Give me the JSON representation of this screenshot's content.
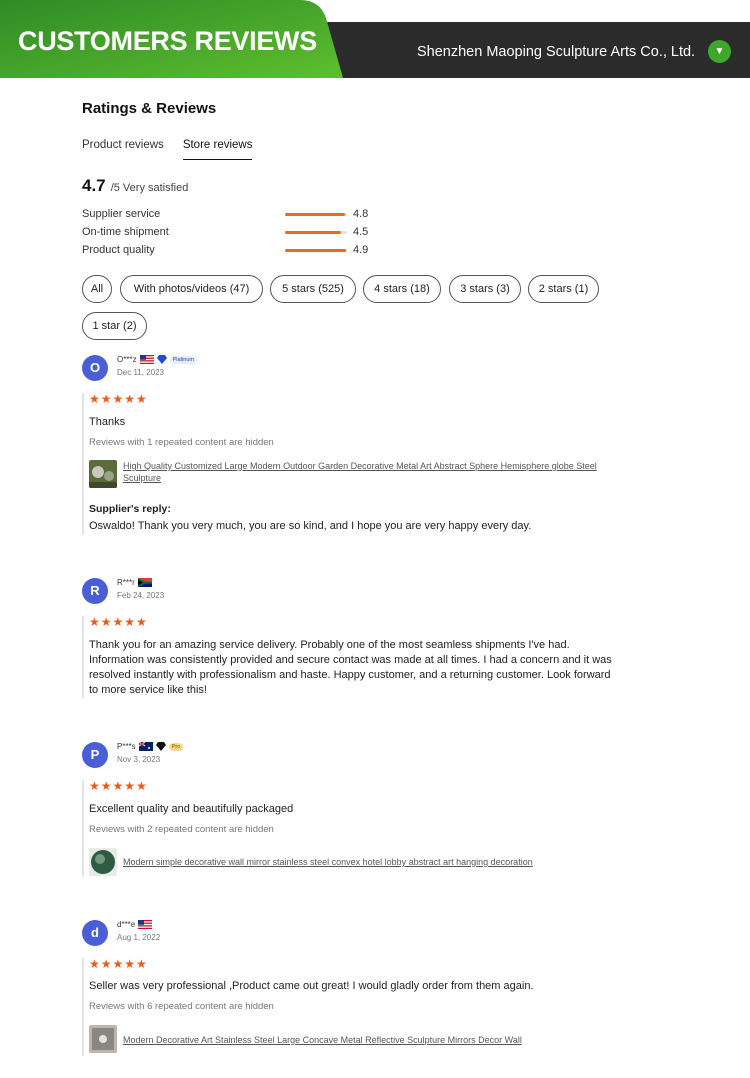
{
  "banner": {
    "title": "CUSTOMERS REVIEWS",
    "company": "Shenzhen Maoping Sculpture Arts Co., Ltd.",
    "dot_icon": "▼"
  },
  "ratings": {
    "title": "Ratings & Reviews",
    "tabs": [
      "Product reviews",
      "Store reviews"
    ],
    "active_tab": "Store reviews",
    "score": "4.7",
    "score_suffix": "/5 Very satisfied",
    "metrics": [
      {
        "label": "Supplier service",
        "value": "4.8",
        "fraction": 0.96
      },
      {
        "label": "On-time shipment",
        "value": "4.5",
        "fraction": 0.9
      },
      {
        "label": "Product quality",
        "value": "4.9",
        "fraction": 0.98
      }
    ]
  },
  "filters": [
    "All",
    "With photos/videos (47)",
    "5 stars (525)",
    "4 stars (18)",
    "3 stars (3)",
    "2 stars (1)",
    "1 star (2)"
  ],
  "reviews": [
    {
      "initial": "O",
      "name": "O***z",
      "badge": "Platinum",
      "date": "Dec 11, 2023",
      "stars": "★★★★★",
      "text": "Thanks",
      "hidden": "Reviews with 1 repeated content are hidden",
      "product": "High Quality Customized Large Modern Outdoor Garden Decorative Metal Art Abstract Sphere Hemisphere globe Steel Sculpture",
      "reply_label": "Supplier's reply:",
      "reply": "Oswaldo! Thank you very much, you are so kind, and I hope you are very happy every day."
    },
    {
      "initial": "R",
      "name": "R***r",
      "date": "Feb 24, 2023",
      "stars": "★★★★★",
      "text": "Thank you for an amazing service delivery. Probably one of the most seamless shipments I've had. Information was consistently provided and secure contact was made at all times. I had a concern and it was resolved instantly with professionalism and haste. Happy customer, and a returning customer. Look forward to more service like this!"
    },
    {
      "initial": "P",
      "name": "P***s",
      "badge": "Pro",
      "date": "Nov 3, 2023",
      "stars": "★★★★★",
      "text": "Excellent quality and beautifully packaged",
      "hidden": "Reviews with 2 repeated content are hidden",
      "product": "Modern simple decorative wall mirror stainless steel convex hotel lobby abstract art hanging decoration"
    },
    {
      "initial": "d",
      "name": "d***e",
      "date": "Aug 1, 2022",
      "stars": "★★★★★",
      "text": "Seller was very professional ,Product came out great! I would gladly order from them again.",
      "hidden": "Reviews with 6 repeated content are hidden",
      "product": "Modern Decorative Art Stainless Steel Large Concave Metal Reflective Sculpture Mirrors Decor Wall"
    }
  ],
  "colors": {
    "banner_green": "#3a9d2c",
    "banner_dark": "#2b2b2b",
    "accent_orange": "#ee6a1c",
    "avatar_blue": "#4a5fd6"
  }
}
